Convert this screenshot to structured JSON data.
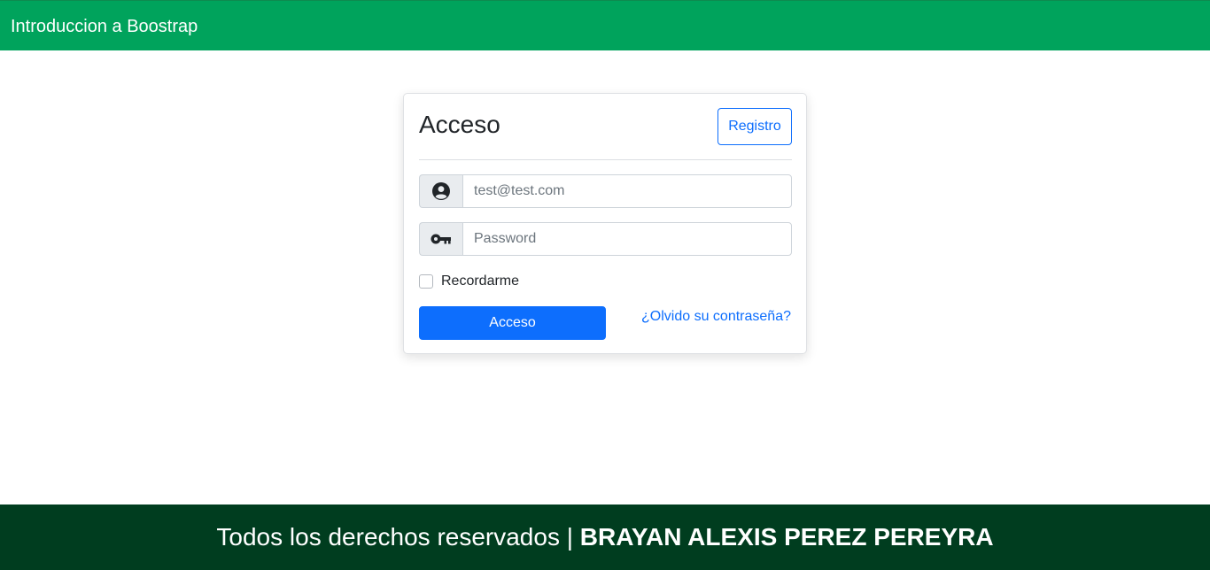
{
  "navbar": {
    "brand": "Introduccion a Boostrap",
    "bg_color": "#00a35c"
  },
  "card": {
    "title": "Acceso",
    "register_button": "Registro",
    "email": {
      "icon": "user-circle-icon",
      "placeholder": "test@test.com",
      "value": ""
    },
    "password": {
      "icon": "key-icon",
      "placeholder": "Password",
      "value": ""
    },
    "remember": {
      "label": "Recordarme",
      "checked": false
    },
    "submit_button": "Acceso",
    "forgot_link": "¿Olvido su contraseña?"
  },
  "footer": {
    "text": "Todos los derechos reservados | ",
    "author": "BRAYAN ALEXIS PEREZ PEREYRA",
    "bg_color": "#003d1f"
  },
  "colors": {
    "primary": "#0d6efd"
  }
}
